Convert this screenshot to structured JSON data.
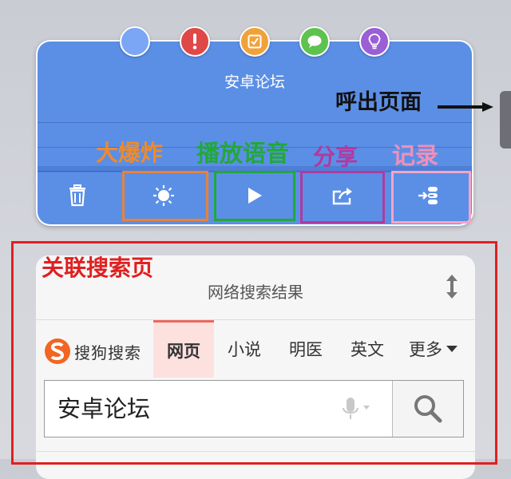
{
  "card": {
    "title": "安卓论坛"
  },
  "dots": [
    {
      "name": "blue-dot",
      "color": "#7aa6f5",
      "icon": "blank"
    },
    {
      "name": "red-dot",
      "color": "#e04848",
      "icon": "exclamation"
    },
    {
      "name": "orange-dot",
      "color": "#f0a23a",
      "icon": "edit-check"
    },
    {
      "name": "green-dot",
      "color": "#5ec24f",
      "icon": "chat-bubble"
    },
    {
      "name": "purple-dot",
      "color": "#9a5fd6",
      "icon": "lightbulb"
    }
  ],
  "toolbar": {
    "items": [
      "trash-icon",
      "sun-burst-icon",
      "play-icon",
      "share-icon",
      "record-icon"
    ]
  },
  "annotations": {
    "callout": "呼出页面",
    "explode": "大爆炸",
    "voice": "播放语音",
    "share": "分享",
    "record": "记录",
    "related": "关联搜索页",
    "colors": {
      "explode": "#f08a2a",
      "voice": "#22a83a",
      "share": "#b03aa0",
      "record": "#f090b8",
      "related": "#e02020",
      "callout": "#111111"
    }
  },
  "search_card": {
    "title": "网络搜索结果",
    "logo_text": "搜狗搜索",
    "tabs": [
      "网页",
      "小说",
      "明医",
      "英文",
      "更多"
    ],
    "active_tab": "网页",
    "query": "安卓论坛"
  }
}
